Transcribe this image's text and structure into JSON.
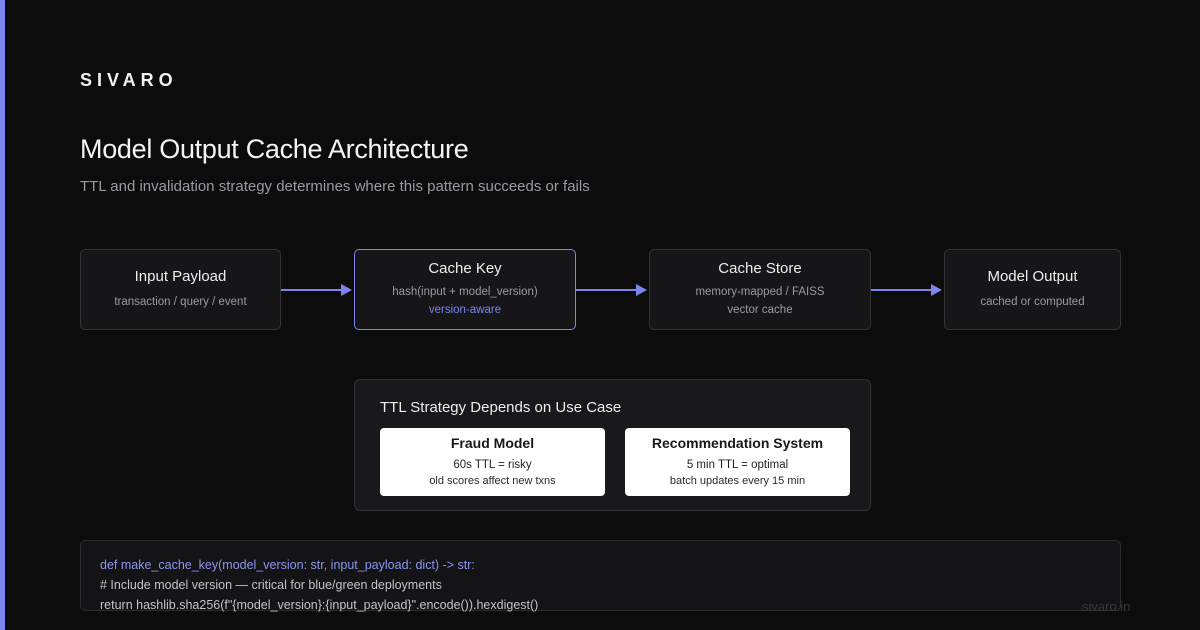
{
  "brand": "SIVARO",
  "title": "Model Output Cache Architecture",
  "subtitle": "TTL and invalidation strategy determines where this pattern succeeds or fails",
  "flow": {
    "nodes": [
      {
        "title": "Input Payload",
        "lines": [
          "transaction / query / event"
        ]
      },
      {
        "title": "Cache Key",
        "lines": [
          "hash(input + model_version)",
          "version-aware"
        ]
      },
      {
        "title": "Cache Store",
        "lines": [
          "memory-mapped / FAISS",
          "vector cache"
        ]
      },
      {
        "title": "Model Output",
        "lines": [
          "cached or computed"
        ]
      }
    ]
  },
  "ttl": {
    "heading": "TTL Strategy Depends on Use Case",
    "cards": [
      {
        "title": "Fraud Model",
        "line1": "60s TTL = risky",
        "line2": "old scores affect new txns"
      },
      {
        "title": "Recommendation System",
        "line1": "5 min TTL = optimal",
        "line2": "batch updates every 15 min"
      }
    ]
  },
  "code": {
    "lines": [
      "def make_cache_key(model_version: str, input_payload: dict) -> str:",
      "# Include model version — critical for blue/green deployments",
      "return hashlib.sha256(f\"{model_version}:{input_payload}\".encode()).hexdigest()"
    ]
  },
  "footer": "sivaro.in",
  "colors": {
    "accent": "#7b85ee",
    "background": "#0c0c0d",
    "node_border": "#333336",
    "card_background": "#ffffff"
  }
}
